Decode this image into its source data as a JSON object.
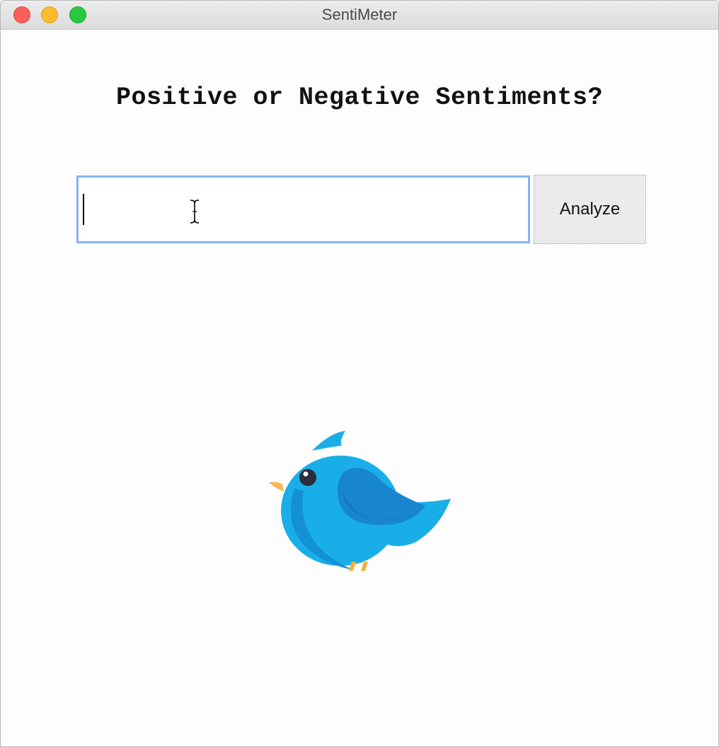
{
  "window": {
    "title": "SentiMeter"
  },
  "main": {
    "heading": "Positive or Negative Sentiments?",
    "input": {
      "value": "",
      "placeholder": ""
    },
    "analyze_label": "Analyze"
  },
  "illustration": {
    "icon": "bird-icon"
  },
  "colors": {
    "accent_focus": "#8ab4f0",
    "bird_body": "#1aaee8",
    "bird_wing": "#1786cf",
    "bird_beak": "#f6b94e",
    "bird_legs": "#f3b041"
  }
}
